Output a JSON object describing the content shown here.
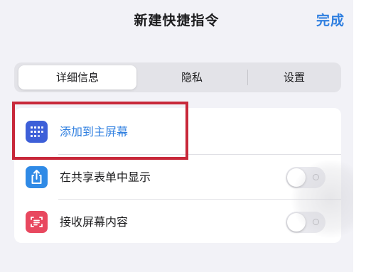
{
  "header": {
    "title": "新建快捷指令",
    "done_label": "完成"
  },
  "tabs": [
    {
      "label": "详细信息",
      "selected": true
    },
    {
      "label": "隐私",
      "selected": false
    },
    {
      "label": "设置",
      "selected": false
    }
  ],
  "rows": [
    {
      "label": "添加到主屏幕",
      "icon": "home-screen-grid-icon",
      "icon_color": "#3d5fd8",
      "label_color": "#2f7fe0"
    },
    {
      "label": "在共享表单中显示",
      "icon": "share-icon",
      "icon_color": "#2f8ae6",
      "toggle_on": false
    },
    {
      "label": "接收屏幕内容",
      "icon": "screen-capture-icon",
      "icon_color": "#e8485f",
      "toggle_on": false
    }
  ],
  "colors": {
    "accent": "#2f7fe0",
    "highlight": "#c8283a",
    "background": "#f2f2f7"
  }
}
